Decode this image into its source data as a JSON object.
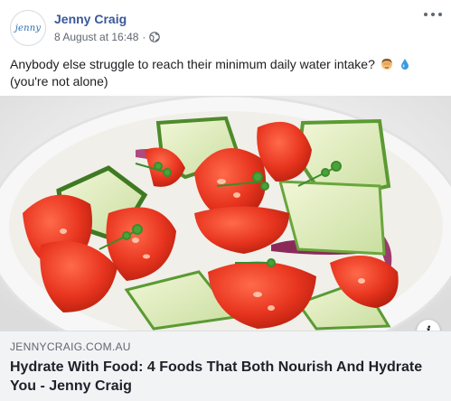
{
  "post": {
    "avatar_logo": "jenny",
    "page_name": "Jenny Craig",
    "timestamp": "8 August at 16:48",
    "separator": "·",
    "privacy_icon": "globe-icon",
    "more_icon": "ellipsis-icon",
    "text_line1": "Anybody else struggle to reach their minimum daily water intake?",
    "text_line2": "(you're not alone)",
    "emojis": [
      "woman-facepalming-emoji",
      "droplet-emoji"
    ]
  },
  "link_preview": {
    "image_description_icon": "salad-bowl-image",
    "info_icon_label": "i",
    "domain": "JENNYCRAIG.COM.AU",
    "title": "Hydrate With Food: 4 Foods That Both Nourish And Hydrate You - Jenny Craig"
  },
  "colors": {
    "page_name": "#385898",
    "meta_text": "#606770",
    "footer_bg": "#f2f3f5",
    "title_text": "#1d2129"
  }
}
